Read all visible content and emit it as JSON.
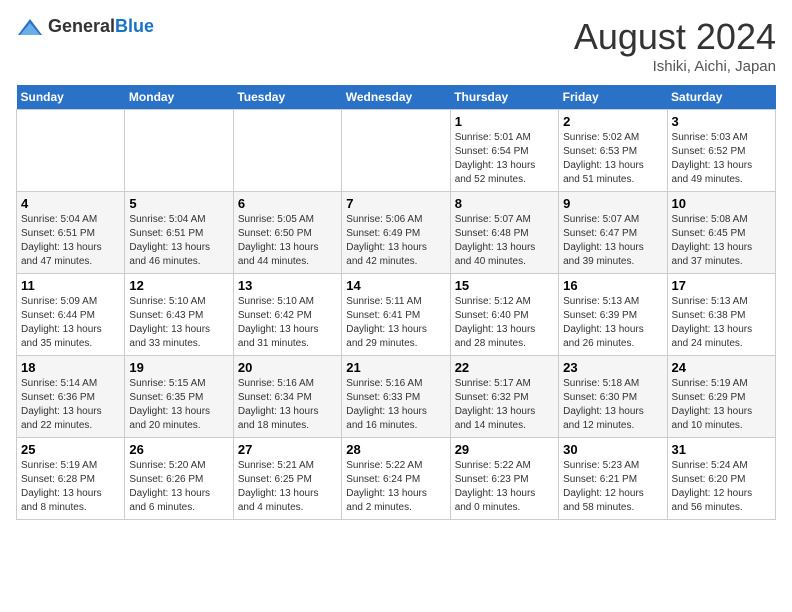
{
  "header": {
    "logo_general": "General",
    "logo_blue": "Blue",
    "month_title": "August 2024",
    "location": "Ishiki, Aichi, Japan"
  },
  "weekdays": [
    "Sunday",
    "Monday",
    "Tuesday",
    "Wednesday",
    "Thursday",
    "Friday",
    "Saturday"
  ],
  "weeks": [
    [
      {
        "day": "",
        "info": ""
      },
      {
        "day": "",
        "info": ""
      },
      {
        "day": "",
        "info": ""
      },
      {
        "day": "",
        "info": ""
      },
      {
        "day": "1",
        "info": "Sunrise: 5:01 AM\nSunset: 6:54 PM\nDaylight: 13 hours\nand 52 minutes."
      },
      {
        "day": "2",
        "info": "Sunrise: 5:02 AM\nSunset: 6:53 PM\nDaylight: 13 hours\nand 51 minutes."
      },
      {
        "day": "3",
        "info": "Sunrise: 5:03 AM\nSunset: 6:52 PM\nDaylight: 13 hours\nand 49 minutes."
      }
    ],
    [
      {
        "day": "4",
        "info": "Sunrise: 5:04 AM\nSunset: 6:51 PM\nDaylight: 13 hours\nand 47 minutes."
      },
      {
        "day": "5",
        "info": "Sunrise: 5:04 AM\nSunset: 6:51 PM\nDaylight: 13 hours\nand 46 minutes."
      },
      {
        "day": "6",
        "info": "Sunrise: 5:05 AM\nSunset: 6:50 PM\nDaylight: 13 hours\nand 44 minutes."
      },
      {
        "day": "7",
        "info": "Sunrise: 5:06 AM\nSunset: 6:49 PM\nDaylight: 13 hours\nand 42 minutes."
      },
      {
        "day": "8",
        "info": "Sunrise: 5:07 AM\nSunset: 6:48 PM\nDaylight: 13 hours\nand 40 minutes."
      },
      {
        "day": "9",
        "info": "Sunrise: 5:07 AM\nSunset: 6:47 PM\nDaylight: 13 hours\nand 39 minutes."
      },
      {
        "day": "10",
        "info": "Sunrise: 5:08 AM\nSunset: 6:45 PM\nDaylight: 13 hours\nand 37 minutes."
      }
    ],
    [
      {
        "day": "11",
        "info": "Sunrise: 5:09 AM\nSunset: 6:44 PM\nDaylight: 13 hours\nand 35 minutes."
      },
      {
        "day": "12",
        "info": "Sunrise: 5:10 AM\nSunset: 6:43 PM\nDaylight: 13 hours\nand 33 minutes."
      },
      {
        "day": "13",
        "info": "Sunrise: 5:10 AM\nSunset: 6:42 PM\nDaylight: 13 hours\nand 31 minutes."
      },
      {
        "day": "14",
        "info": "Sunrise: 5:11 AM\nSunset: 6:41 PM\nDaylight: 13 hours\nand 29 minutes."
      },
      {
        "day": "15",
        "info": "Sunrise: 5:12 AM\nSunset: 6:40 PM\nDaylight: 13 hours\nand 28 minutes."
      },
      {
        "day": "16",
        "info": "Sunrise: 5:13 AM\nSunset: 6:39 PM\nDaylight: 13 hours\nand 26 minutes."
      },
      {
        "day": "17",
        "info": "Sunrise: 5:13 AM\nSunset: 6:38 PM\nDaylight: 13 hours\nand 24 minutes."
      }
    ],
    [
      {
        "day": "18",
        "info": "Sunrise: 5:14 AM\nSunset: 6:36 PM\nDaylight: 13 hours\nand 22 minutes."
      },
      {
        "day": "19",
        "info": "Sunrise: 5:15 AM\nSunset: 6:35 PM\nDaylight: 13 hours\nand 20 minutes."
      },
      {
        "day": "20",
        "info": "Sunrise: 5:16 AM\nSunset: 6:34 PM\nDaylight: 13 hours\nand 18 minutes."
      },
      {
        "day": "21",
        "info": "Sunrise: 5:16 AM\nSunset: 6:33 PM\nDaylight: 13 hours\nand 16 minutes."
      },
      {
        "day": "22",
        "info": "Sunrise: 5:17 AM\nSunset: 6:32 PM\nDaylight: 13 hours\nand 14 minutes."
      },
      {
        "day": "23",
        "info": "Sunrise: 5:18 AM\nSunset: 6:30 PM\nDaylight: 13 hours\nand 12 minutes."
      },
      {
        "day": "24",
        "info": "Sunrise: 5:19 AM\nSunset: 6:29 PM\nDaylight: 13 hours\nand 10 minutes."
      }
    ],
    [
      {
        "day": "25",
        "info": "Sunrise: 5:19 AM\nSunset: 6:28 PM\nDaylight: 13 hours\nand 8 minutes."
      },
      {
        "day": "26",
        "info": "Sunrise: 5:20 AM\nSunset: 6:26 PM\nDaylight: 13 hours\nand 6 minutes."
      },
      {
        "day": "27",
        "info": "Sunrise: 5:21 AM\nSunset: 6:25 PM\nDaylight: 13 hours\nand 4 minutes."
      },
      {
        "day": "28",
        "info": "Sunrise: 5:22 AM\nSunset: 6:24 PM\nDaylight: 13 hours\nand 2 minutes."
      },
      {
        "day": "29",
        "info": "Sunrise: 5:22 AM\nSunset: 6:23 PM\nDaylight: 13 hours\nand 0 minutes."
      },
      {
        "day": "30",
        "info": "Sunrise: 5:23 AM\nSunset: 6:21 PM\nDaylight: 12 hours\nand 58 minutes."
      },
      {
        "day": "31",
        "info": "Sunrise: 5:24 AM\nSunset: 6:20 PM\nDaylight: 12 hours\nand 56 minutes."
      }
    ]
  ]
}
